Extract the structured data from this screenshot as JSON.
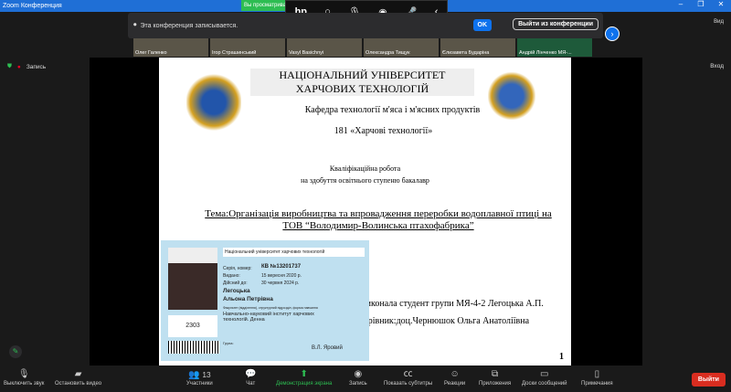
{
  "window": {
    "title": "Zoom Конференция",
    "minimize": "–",
    "restore": "❐",
    "close": "✕"
  },
  "banner": {
    "text": "Вы просматриваете"
  },
  "hp_bar": {
    "logo": "hp"
  },
  "notice": {
    "text": "Эта конференция записывается.",
    "ok": "OK",
    "leave": "Выйти из конференции"
  },
  "view_label": "Вид",
  "participants": [
    "Олег Галенко",
    "Ігор Страшинський",
    "Vasyl Basichnyi",
    "Олександра Тищук",
    "Єлизавета Бударіна",
    "Андрій Лінченко МЯ-..."
  ],
  "recording": {
    "label": "Запись"
  },
  "enter_label": "Вход",
  "slide": {
    "title": "НАЦІОНАЛЬНИЙ УНІВЕРСИТЕТ ХАРЧОВИХ ТЕХНОЛОГІЙ",
    "department": "Кафедра технології м'яса і м'ясних продуктів",
    "specialty": "181 «Харчові технології»",
    "work": "Кваліфікаційна робота",
    "degree": "на здобуття освітнього ступеню бакалавр",
    "topic": "Тема:Організація виробництва та впровадження переробки водоплавної птиці на ТОВ “Володимир-Волинська птахофабрика”",
    "author": "Виконала студент групи МЯ-4-2 Легоцька А.П.",
    "supervisor": "Керівник:доц.Чернюшок Ольга Анатоліївна",
    "page": "1"
  },
  "id_card": {
    "university": "Національний університет харчових технологій",
    "series_label": "Серія, номер:",
    "series": "КВ №13201737",
    "issued_label": "Видано:",
    "issued": "15 вересня 2020 р.",
    "valid_label": "Дійсний до:",
    "valid": "30 червня 2024 р.",
    "surname": "Легоцька",
    "name": "Альона Петрівна",
    "faculty_label": "Факультет (відділення), структурний підрозділ, форма навчання",
    "institute": "Навчально-науковий інститут харчових технологій. Денна",
    "number": "2303",
    "group_label": "Група:",
    "signer": "В.Л. Яровий"
  },
  "toolbar": {
    "mute": "Выключить звук",
    "video": "Остановить видео",
    "participants": "Участники",
    "participants_count": "13",
    "chat": "Чат",
    "share": "Демонстрация экрана",
    "record": "Запись",
    "captions": "Показать субтитры",
    "reactions": "Реакции",
    "apps": "Приложения",
    "whiteboards": "Доски сообщений",
    "notes": "Примечания",
    "leave": "Выйти"
  },
  "colors": {
    "accent": "#0e72ed",
    "share": "#2dbd52",
    "leave": "#d92d20"
  }
}
